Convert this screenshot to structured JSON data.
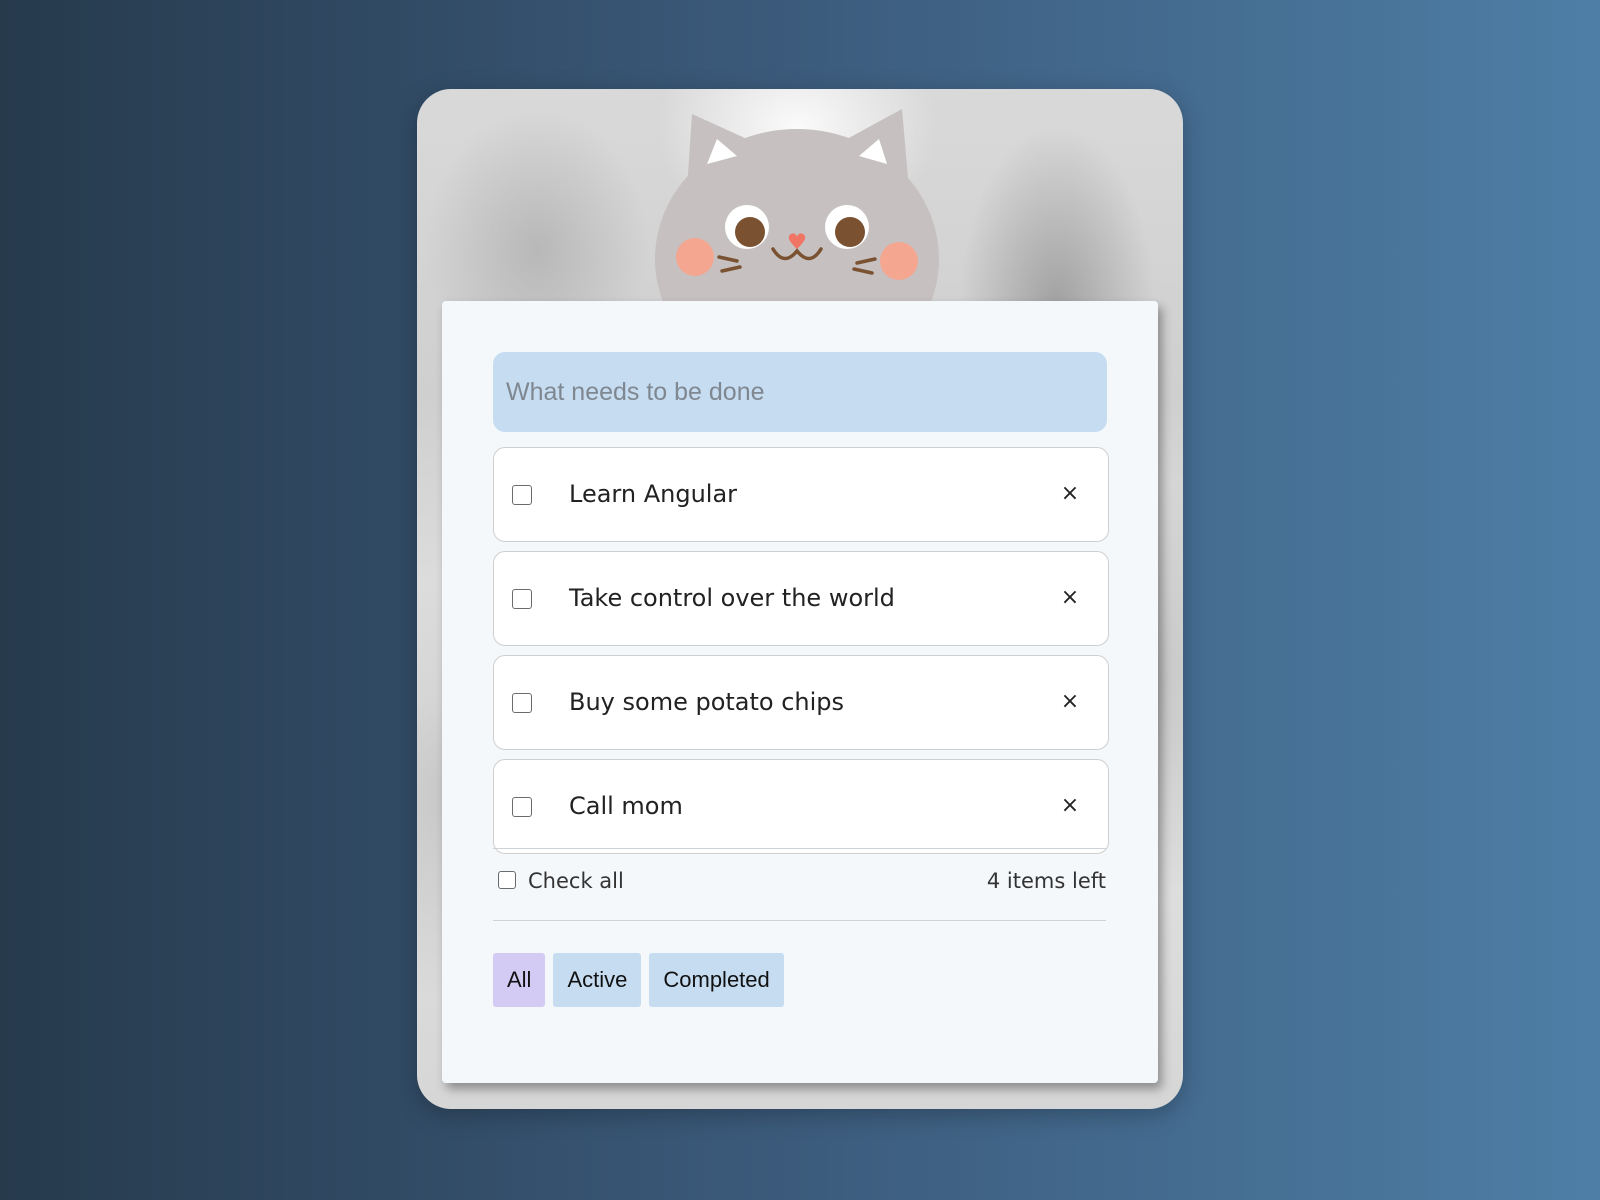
{
  "new_todo": {
    "placeholder": "What needs to be done"
  },
  "todos": [
    {
      "title": "Learn Angular",
      "completed": false
    },
    {
      "title": "Take control over the world",
      "completed": false
    },
    {
      "title": "Buy some potato chips",
      "completed": false
    },
    {
      "title": "Call mom",
      "completed": false
    }
  ],
  "destroy_label": "×",
  "footer": {
    "check_all_label": "Check all",
    "items_left": "4 items left"
  },
  "filters": [
    {
      "label": "All",
      "selected": true
    },
    {
      "label": "Active",
      "selected": false
    },
    {
      "label": "Completed",
      "selected": false
    }
  ],
  "colors": {
    "input_bg": "#c6dcf1",
    "filter_bg": "#c6dcf1",
    "filter_selected_bg": "#d3cbf3",
    "panel_bg": "#f5f8fb"
  },
  "icons": {
    "mascot": "cat-icon",
    "delete": "close-icon"
  }
}
